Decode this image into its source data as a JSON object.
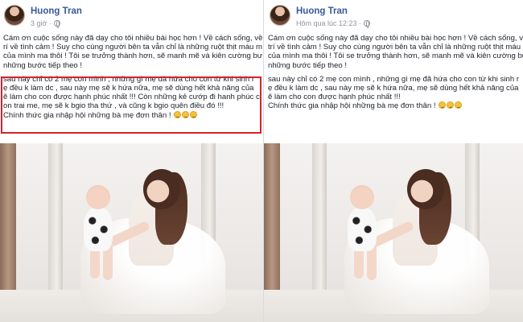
{
  "left_post": {
    "author_name": "Huong Tran",
    "timestamp": "3 giờ ·",
    "privacy_icon": "globe-icon",
    "paragraphs": [
      [
        "Cám ơn cuộc sống này đã dạy cho tôi nhiều bài học hơn ! Về cách sống, về",
        "rí về tình cảm ! Suy cho cùng người bên ta vẫn chỉ là những ruột thịt máu m",
        "của mình ma thôi ! Tôi se trưởng thành hơn, sẽ manh mẽ và kiên cường bư",
        "những bước tiếp theo !"
      ],
      [
        "sau này chỉ có 2 mẹ con mình , những gì mẹ đã hứa cho con từ khi sinh r",
        "ẹ đều k làm dc , sau này mẹ sẽ k hứa nữa, mẹ sẽ dùng hết khả năng của",
        "ẽ làm cho con được hạnh phúc nhất !!! Còn những kẻ cướp đi hanh phúc c",
        "on trai me, mẹ sẽ k bgio tha thứ , và cũng k bgio quên điều đó !!!",
        "Chính thức gia nhập hội những bà mẹ đơn thân !"
      ]
    ]
  },
  "right_post": {
    "author_name": "Huong Tran",
    "timestamp": "Hôm qua lúc 12:23 ·",
    "privacy_icon": "globe-icon",
    "paragraphs": [
      [
        "Cám ơn cuộc sống này đã dạy cho tôi nhiều bài học hơn ! Về cách sống, v",
        "trí về tình cảm ! Suy cho cùng người bên ta vẫn chỉ là những ruột thịt máu m",
        "của mình ma thôi ! Tôi se trưởng thành hơn, sẽ manh mẽ và kiên cường bư",
        "những bước tiếp theo !"
      ],
      [
        "sau này chỉ có 2 mẹ con mình , những gì mẹ đã hứa cho con từ khi sinh r",
        "ẹ đều k làm dc , sau này mẹ sẽ k hứa nữa, mẹ sẽ dùng hết khả năng của",
        "ẽ làm cho con được hạnh phúc nhất !!!",
        "Chính thức gia nhập hội những bà mẹ đơn thân !"
      ]
    ]
  },
  "colors": {
    "author": "#385898",
    "highlight_border": "#d6222a",
    "meta": "#90949c"
  }
}
